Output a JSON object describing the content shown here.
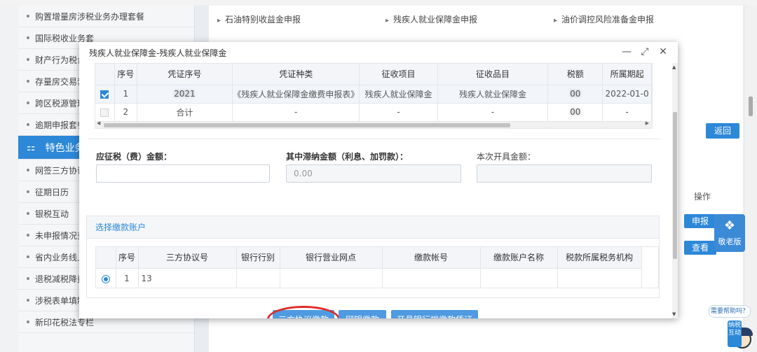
{
  "sidebar": {
    "items": [
      {
        "label": "购置增量房涉税业务办理套餐"
      },
      {
        "label": "国际税收业务套"
      },
      {
        "label": "财产行为税合"
      },
      {
        "label": "存量房交易套"
      },
      {
        "label": "跨区税源管理"
      },
      {
        "label": "逾期申报套餐"
      },
      {
        "label": "特色业务"
      },
      {
        "label": "网签三方协议"
      },
      {
        "label": "征期日历"
      },
      {
        "label": "银税互动"
      },
      {
        "label": "未申报情况查"
      },
      {
        "label": "省内业务线上"
      },
      {
        "label": "退税减税降费"
      },
      {
        "label": "涉税表单填制"
      },
      {
        "label": "新印花税法专栏"
      }
    ]
  },
  "top_links": [
    "石油特别收益金申报",
    "残疾人就业保障金申报",
    "油价调控风险准备金申报"
  ],
  "background_page": {
    "return_button": "返回",
    "operation_label": "操作",
    "declare_button": "申报",
    "view_button": "查看",
    "care_badge": "敬老版",
    "help_bubble": "需要帮助吗？",
    "mascot_tag": "纳税互动"
  },
  "modal": {
    "title": "残疾人就业保障金-残疾人就业保障金",
    "controls": {
      "minimize": "—",
      "maximize": "⤢",
      "close": "✕"
    },
    "voucher_table": {
      "columns": [
        "",
        "序号",
        "凭证序号",
        "凭证种类",
        "征收项目",
        "征收品目",
        "税额",
        "所属期起"
      ],
      "rows": [
        {
          "checked": true,
          "no": "1",
          "voucher_no": "2021",
          "voucher_type": "《残疾人就业保障金缴费申报表》",
          "levy_item": "残疾人就业保障金",
          "levy_category": "残疾人就业保障金",
          "amount": "00",
          "period_start": "2022-01-0"
        },
        {
          "checked": false,
          "no": "2",
          "voucher_no": "合计",
          "voucher_type": "-",
          "levy_item": "-",
          "levy_category": "-",
          "amount": "00",
          "period_start": "-"
        }
      ]
    },
    "fields": {
      "payable_label": "应征税（费）金额：",
      "payable_value": "",
      "late_fee_label": "其中滞纳金额（利息、加罚款）：",
      "late_fee_value": "0.00",
      "issue_label": "本次开具金额：",
      "issue_value": ""
    },
    "account_section": {
      "title": "选择缴款账户",
      "columns": [
        "",
        "序号",
        "三方协议号",
        "银行行别",
        "银行营业网点",
        "缴款帐号",
        "缴款账户名称",
        "税款所属税务机构"
      ],
      "rows": [
        {
          "selected": true,
          "no": "1",
          "agreement_no": "13"
        }
      ]
    },
    "buttons": {
      "tripartite_pay": "三方协议缴款",
      "online_bank_pay": "网银缴款",
      "bank_voucher": "开具银行端缴款凭证"
    }
  },
  "colors": {
    "accent": "#2d88d8",
    "highlight_ring": "#e02a2a"
  }
}
